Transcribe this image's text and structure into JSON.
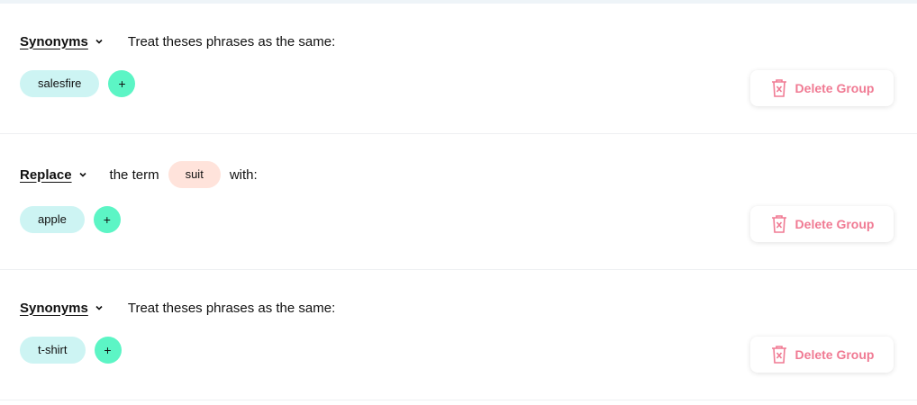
{
  "groups": [
    {
      "type_label": "Synonyms",
      "description": "Treat theses phrases as the same:",
      "chips": [
        "salesfire"
      ],
      "add_label": "+",
      "delete_label": "Delete Group"
    },
    {
      "type_label": "Replace",
      "description_before": "the term",
      "term": "suit",
      "description_after": "with:",
      "chips": [
        "apple"
      ],
      "add_label": "+",
      "delete_label": "Delete Group"
    },
    {
      "type_label": "Synonyms",
      "description": "Treat theses phrases as the same:",
      "chips": [
        "t-shirt"
      ],
      "add_label": "+",
      "delete_label": "Delete Group"
    }
  ],
  "icons": {
    "type_dropdown": "chevron-down-icon",
    "delete": "trash-icon"
  },
  "colors": {
    "chip_bg": "#cdf4f3",
    "add_button_bg": "#5cf5c5",
    "term_chip_bg": "#ffe3db",
    "delete_text": "#f07a93"
  }
}
